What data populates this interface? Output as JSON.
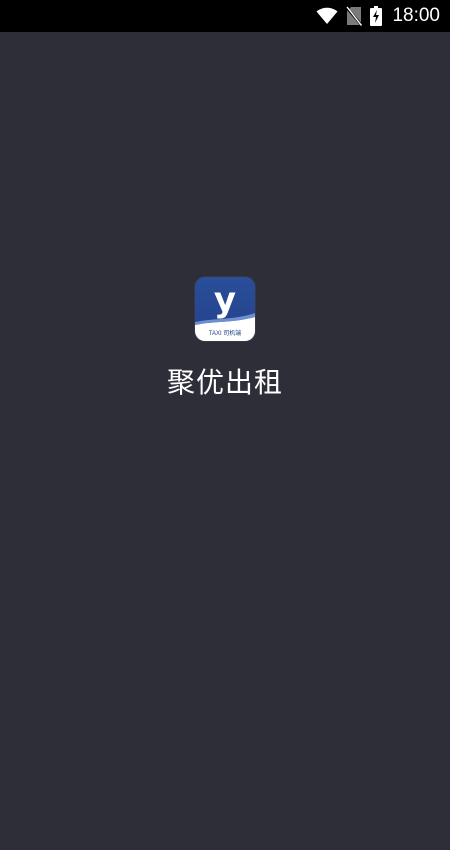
{
  "status_bar": {
    "time": "18:00",
    "icons": [
      "wifi-icon",
      "no-sim-icon",
      "battery-charging-icon"
    ]
  },
  "splash": {
    "app_name": "聚优出租",
    "logo": {
      "letter": "y",
      "caption": "TAXI 司机端",
      "colors": {
        "primary": "#2a4e9a",
        "wave": "#ffffff",
        "text": "#1f3d82"
      }
    }
  },
  "colors": {
    "background": "#2e2e39",
    "status_bar": "#000000",
    "text": "#ffffff"
  }
}
